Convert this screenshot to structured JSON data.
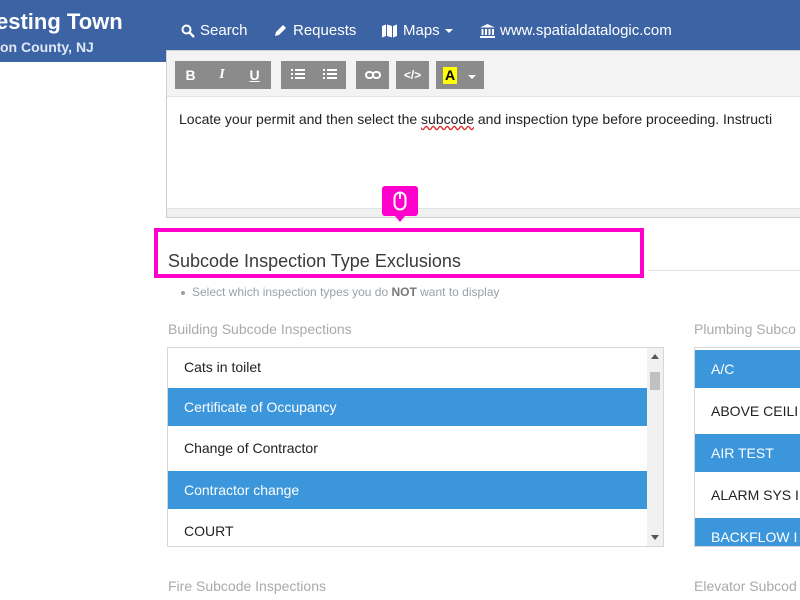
{
  "header": {
    "title": "esting Town",
    "subtitle": "on County, NJ",
    "nav": [
      {
        "label": "Search",
        "icon": "search-icon"
      },
      {
        "label": "Requests",
        "icon": "pencil-icon"
      },
      {
        "label": "Maps",
        "icon": "map-icon"
      },
      {
        "label": "www.spatialdatalogic.com",
        "icon": "bank-icon"
      }
    ]
  },
  "editor": {
    "toolbar": [
      "B",
      "I",
      "U",
      "list-ul-icon",
      "list-ol-icon",
      "link-icon",
      "</>",
      "A"
    ],
    "text_before": "Locate your permit and then select the ",
    "text_spell": "subcode",
    "text_after": " and inspection type before proceeding. Instructi"
  },
  "section": {
    "title": "Subcode Inspection Type Exclusions",
    "hint_before": "Select which inspection types you do ",
    "hint_bold": "NOT",
    "hint_after": " want to display"
  },
  "groups": {
    "building": {
      "label": "Building Subcode Inspections",
      "items": [
        {
          "text": "Cats in toilet",
          "selected": false
        },
        {
          "text": "Certificate of Occupancy",
          "selected": true
        },
        {
          "text": "Change of Contractor",
          "selected": false
        },
        {
          "text": "Contractor change",
          "selected": true
        },
        {
          "text": "COURT",
          "selected": false
        }
      ]
    },
    "plumbing": {
      "label": "Plumbing Subco",
      "items": [
        {
          "text": "A/C",
          "selected": true
        },
        {
          "text": "ABOVE CEILI",
          "selected": false
        },
        {
          "text": "AIR TEST",
          "selected": true
        },
        {
          "text": "ALARM SYS I",
          "selected": false
        },
        {
          "text": "BACKFLOW I",
          "selected": true
        }
      ]
    },
    "fire": {
      "label": "Fire Subcode Inspections"
    },
    "elevator": {
      "label": "Elevator Subcod"
    }
  },
  "colors": {
    "header_bg": "#3c64a4",
    "selected_bg": "#3c96db",
    "annotation": "#ff00cc"
  }
}
